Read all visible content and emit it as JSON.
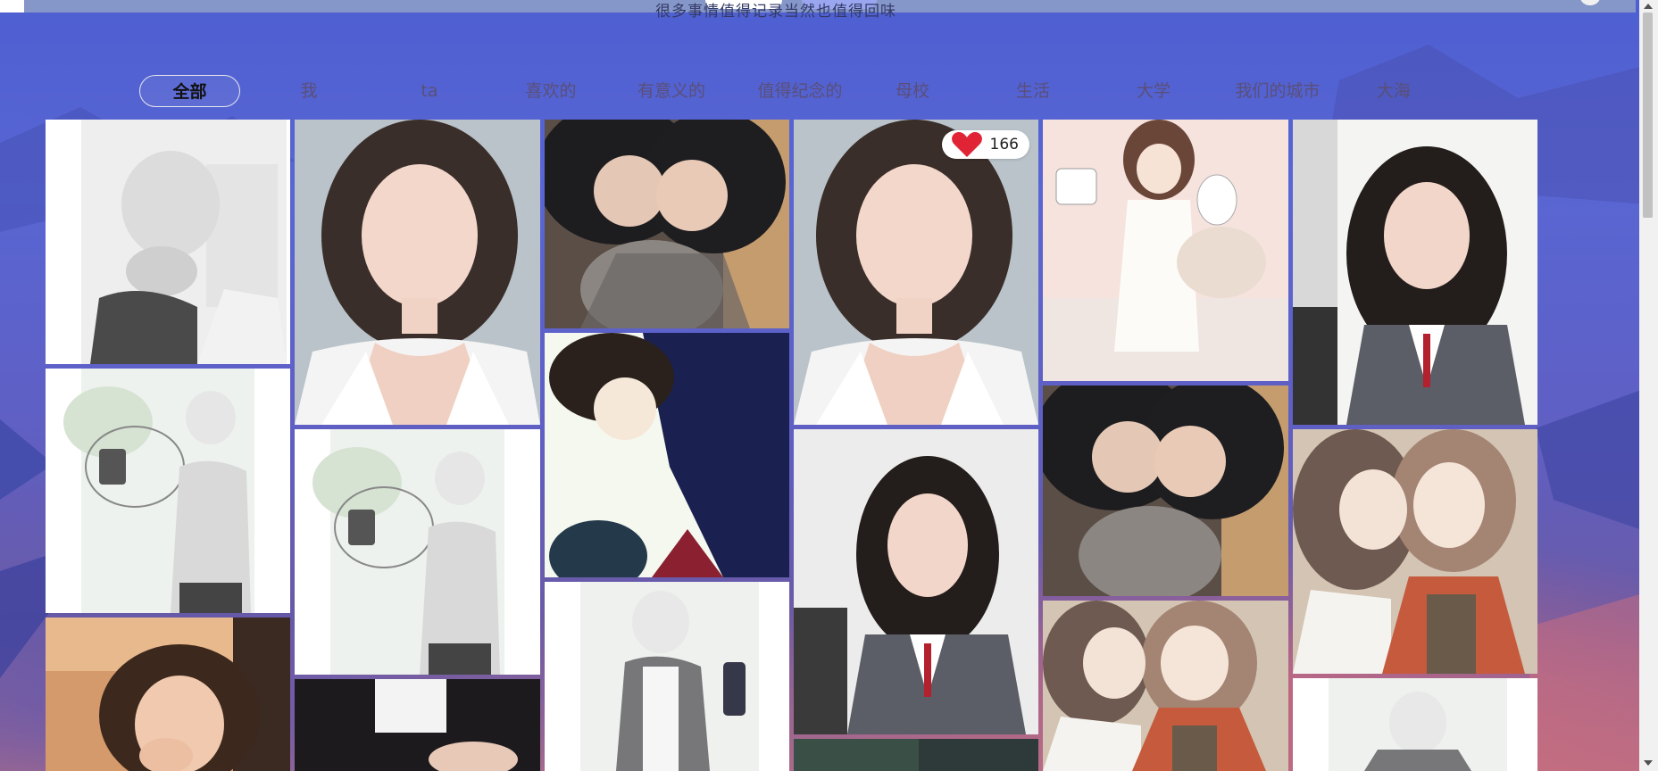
{
  "header": {
    "subtitle": "很多事情值得记录当然也值得回味"
  },
  "tabs": [
    {
      "label": "全部",
      "active": true
    },
    {
      "label": "我",
      "active": false
    },
    {
      "label": "ta",
      "active": false
    },
    {
      "label": "喜欢的",
      "active": false
    },
    {
      "label": "有意义的",
      "active": false
    },
    {
      "label": "值得纪念的",
      "active": false
    },
    {
      "label": "母校",
      "active": false
    },
    {
      "label": "生活",
      "active": false
    },
    {
      "label": "大学",
      "active": false
    },
    {
      "label": "我们的城市",
      "active": false
    },
    {
      "label": "大海",
      "active": false
    }
  ],
  "gallery": {
    "like_count": "166",
    "like_icon": "heart-icon"
  },
  "colors": {
    "accent": "#4e5fd2",
    "heart": "#e02436"
  }
}
